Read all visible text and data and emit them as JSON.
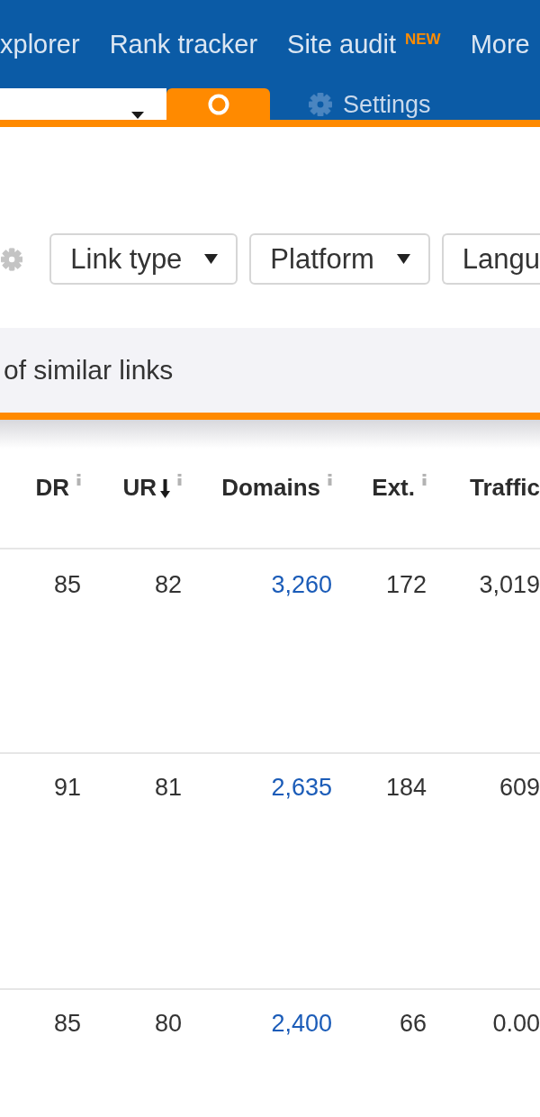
{
  "top_nav": {
    "items": [
      {
        "label": "xplorer"
      },
      {
        "label": "Rank tracker"
      },
      {
        "label": "Site audit",
        "badge": "NEW"
      },
      {
        "label": "More"
      }
    ]
  },
  "search_bar": {
    "settings_label": "Settings"
  },
  "filters": {
    "buttons": [
      {
        "label": "Link type",
        "caret": true
      },
      {
        "label": "Platform",
        "caret": true
      },
      {
        "label": "Langu",
        "caret": false
      }
    ]
  },
  "notice": {
    "text": "of similar links"
  },
  "table": {
    "columns": [
      {
        "label": "DR",
        "kind": "number",
        "sorted": false,
        "info": true
      },
      {
        "label": "UR",
        "kind": "number",
        "sorted": true,
        "info": true
      },
      {
        "label": "Domains",
        "kind": "link",
        "sorted": false,
        "info": true
      },
      {
        "label": "Ext.",
        "kind": "number",
        "sorted": false,
        "info": true
      },
      {
        "label": "Traffic",
        "kind": "number",
        "sorted": false,
        "info": false
      }
    ],
    "rows": [
      {
        "cells": [
          "85",
          "82",
          "3,260",
          "172",
          "3,019"
        ]
      },
      {
        "cells": [
          "91",
          "81",
          "2,635",
          "184",
          "609"
        ]
      },
      {
        "cells": [
          "85",
          "80",
          "2,400",
          "66",
          "0.00"
        ]
      }
    ]
  }
}
